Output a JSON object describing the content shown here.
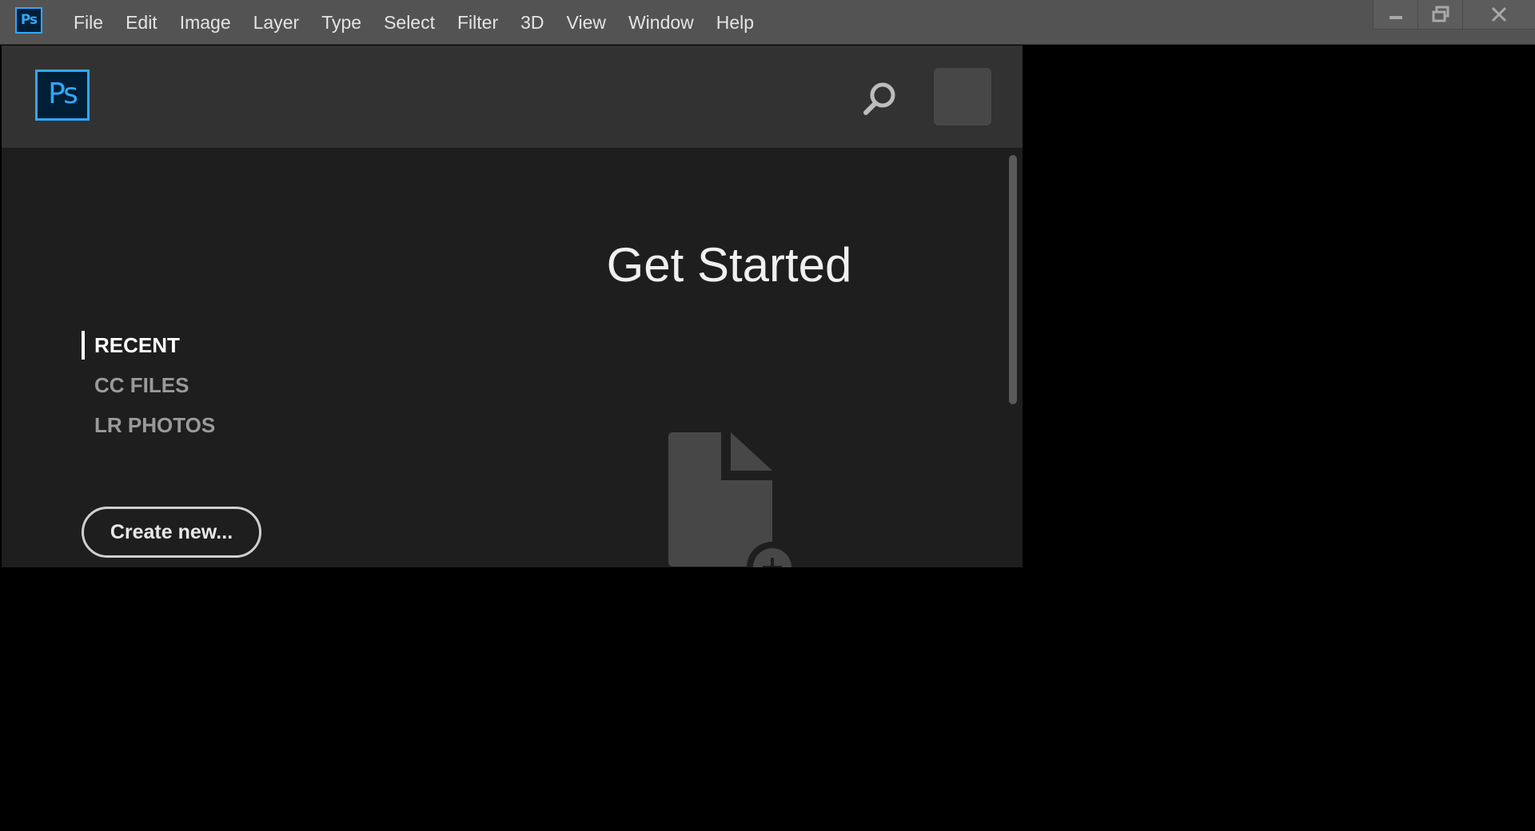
{
  "app": {
    "icon_text": "Ps"
  },
  "menu": {
    "items": [
      "File",
      "Edit",
      "Image",
      "Layer",
      "Type",
      "Select",
      "Filter",
      "3D",
      "View",
      "Window",
      "Help"
    ]
  },
  "window_controls": {
    "icons": [
      "minimize-icon",
      "restore-icon",
      "close-icon"
    ]
  },
  "panel": {
    "logo_text": "Ps",
    "title": "Get Started",
    "nav": {
      "items": [
        {
          "label": "RECENT",
          "active": true
        },
        {
          "label": "CC FILES",
          "active": false
        },
        {
          "label": "LR PHOTOS",
          "active": false
        }
      ]
    },
    "create_label": "Create new..."
  },
  "colors": {
    "menubar": "#535353",
    "panel_header": "#323232",
    "panel_body": "#1e1e1e",
    "ps_blue": "#31a8ff",
    "ps_dark": "#001e36"
  }
}
